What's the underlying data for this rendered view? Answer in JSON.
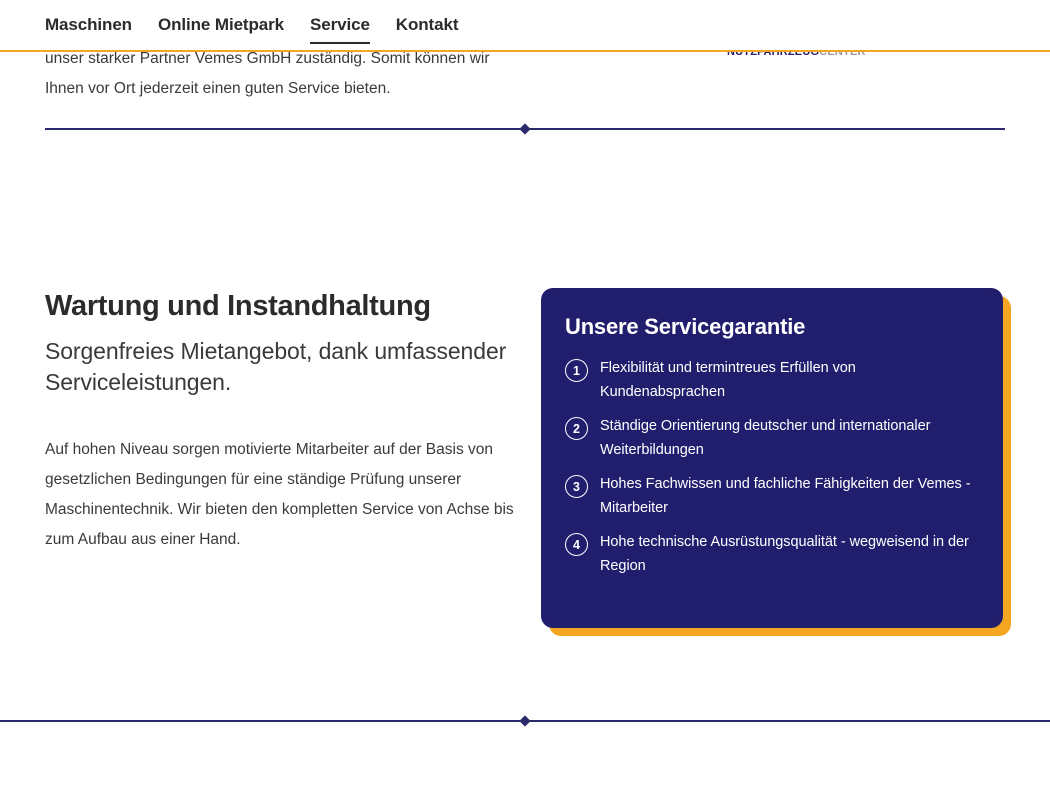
{
  "header": {
    "nav_items": [
      {
        "label": "Maschinen",
        "active": false
      },
      {
        "label": "Online Mietpark",
        "active": false
      },
      {
        "label": "Service",
        "active": true
      },
      {
        "label": "Kontakt",
        "active": false
      }
    ],
    "accent_color": "#f4a620"
  },
  "brand": {
    "mark_strong": "NUTZFAHRZEUG",
    "mark_light": "CENTER"
  },
  "clipped_intro": {
    "line_clipped": "unser starker Partner Vemes GmbH zuständig. Somit können wir",
    "line_visible": "Ihnen vor Ort jederzeit einen guten Service bieten."
  },
  "main": {
    "title": "Wartung und Instandhaltung",
    "subtitle": "Sorgenfreies Mietangebot, dank umfassender Serviceleistungen.",
    "body": "Auf hohen Niveau sorgen motivierte Mitarbeiter auf der Basis von gesetzlichen Bedingungen für eine ständige Prüfung unserer Maschinentechnik. Wir bieten den kompletten Service von Achse bis zum Aufbau aus einer Hand."
  },
  "card": {
    "title": "Unsere Servicegarantie",
    "background_color": "#221e6e",
    "shadow_color": "#f4a620",
    "items": [
      {
        "number": "1",
        "text": "Flexibilität und termintreues Erfüllen von Kundenabsprachen"
      },
      {
        "number": "2",
        "text": "Ständige Orientierung deutscher und internationaler Weiterbildungen"
      },
      {
        "number": "3",
        "text": "Hohes Fachwissen und fachliche Fähigkeiten der Vemes - Mitarbeiter"
      },
      {
        "number": "4",
        "text": "Hohe technische Ausrüstungsqualität - wegweisend in der Region"
      }
    ]
  },
  "dividers": {
    "color": "#2b2a6b"
  }
}
